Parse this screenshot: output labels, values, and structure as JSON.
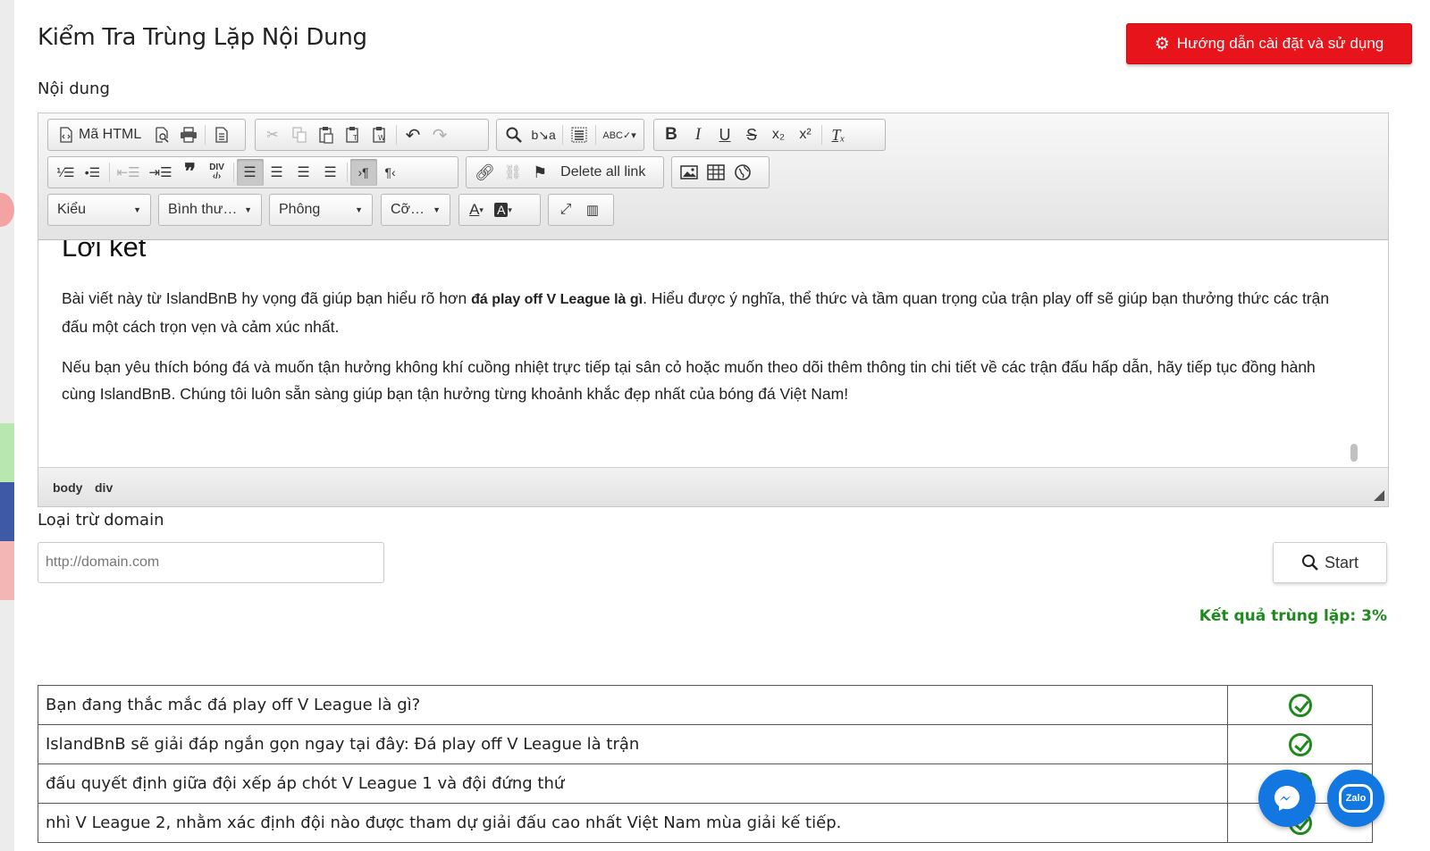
{
  "page": {
    "title": "Kiểm Tra Trùng Lặp Nội Dung",
    "guide_button": "Hướng dẫn cài đặt và sử dụng",
    "content_label": "Nội dung",
    "domain_label": "Loại trừ domain",
    "domain_placeholder": "http://domain.com",
    "start_button": "Start",
    "result_text": "Kết quả trùng lặp: 3%"
  },
  "toolbar": {
    "source_label": "Mã HTML",
    "delete_links_label": "Delete all link",
    "combos": {
      "style": "Kiểu",
      "format": "Bình thư…",
      "font": "Phông",
      "size": "Cỡ…"
    },
    "icons": {
      "row1": [
        "source-icon",
        "preview-icon",
        "print-icon",
        "template-icon",
        "cut-icon",
        "copy-icon",
        "paste-icon",
        "paste-text-icon",
        "paste-word-icon",
        "undo-icon",
        "redo-icon",
        "find-icon",
        "replace-icon",
        "select-all-icon",
        "spellcheck-icon",
        "bold-icon",
        "italic-icon",
        "underline-icon",
        "strike-icon",
        "subscript-icon",
        "superscript-icon",
        "remove-format-icon"
      ],
      "row2": [
        "numbered-list-icon",
        "bulleted-list-icon",
        "outdent-icon",
        "indent-icon",
        "blockquote-icon",
        "div-icon",
        "align-left-icon",
        "align-center-icon",
        "align-right-icon",
        "justify-icon",
        "ltr-icon",
        "rtl-icon",
        "link-icon",
        "unlink-icon",
        "anchor-icon",
        "image-icon",
        "table-icon",
        "iframe-icon"
      ],
      "row3": [
        "text-color-icon",
        "bg-color-icon",
        "maximize-icon",
        "show-blocks-icon"
      ]
    }
  },
  "editor": {
    "heading": "Lời kết",
    "p1_before": "Bài viết này từ IslandBnB hy vọng đã giúp bạn hiểu rõ hơn ",
    "p1_bold": "đá play off V League là gì",
    "p1_after": ". Hiểu được ý nghĩa, thể thức và tầm quan trọng của trận play off sẽ giúp bạn thưởng thức các trận đấu một cách trọn vẹn và cảm xúc nhất.",
    "p2": "Nếu bạn yêu thích bóng đá và muốn tận hưởng không khí cuồng nhiệt trực tiếp tại sân cỏ hoặc muốn theo dõi thêm thông tin chi tiết về các trận đấu hấp dẫn, hãy tiếp tục đồng hành cùng IslandBnB. Chúng tôi luôn sẵn sàng giúp bạn tận hưởng từng khoảnh khắc đẹp nhất của bóng đá Việt Nam!",
    "path": [
      "body",
      "div"
    ]
  },
  "results": [
    {
      "text": "Bạn đang thắc mắc đá play off V League là gì?",
      "status": "ok"
    },
    {
      "text": "IslandBnB sẽ giải đáp ngắn gọn ngay tại đây: Đá play off V League là trận",
      "status": "ok"
    },
    {
      "text": "đấu quyết định giữa đội xếp áp chót V League 1 và đội đứng thứ",
      "status": "ok"
    },
    {
      "text": "nhì V League 2, nhằm xác định đội nào được tham dự giải đấu cao nhất Việt Nam mùa giải kế tiếp.",
      "status": "ok"
    }
  ],
  "chat": {
    "zalo_label": "Zalo"
  },
  "colors": {
    "guide_button": "#e8141c",
    "result_text": "#1e8a1e",
    "check": "#1e8a1e",
    "chat_button": "#1277e1"
  }
}
